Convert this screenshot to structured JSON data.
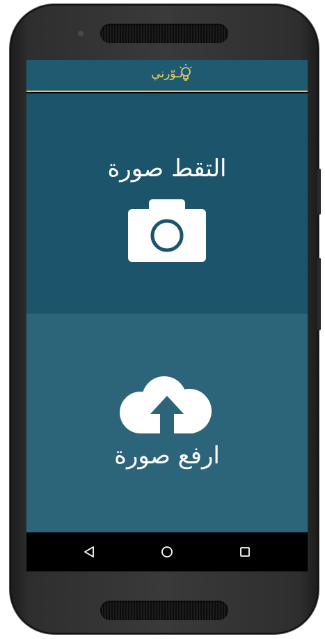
{
  "app": {
    "logo_text": "نـوّرني",
    "accent_color": "#e6c65a",
    "appbar_color": "#1f5a71"
  },
  "actions": {
    "capture": {
      "label": "التقط صورة",
      "icon": "camera-icon"
    },
    "upload": {
      "label": "ارفع صورة",
      "icon": "cloud-upload-icon"
    }
  },
  "colors": {
    "top_panel": "#1c546c",
    "bottom_panel": "#2c6479"
  },
  "navbar": {
    "back": "back-icon",
    "home": "home-icon",
    "recents": "recents-icon"
  }
}
